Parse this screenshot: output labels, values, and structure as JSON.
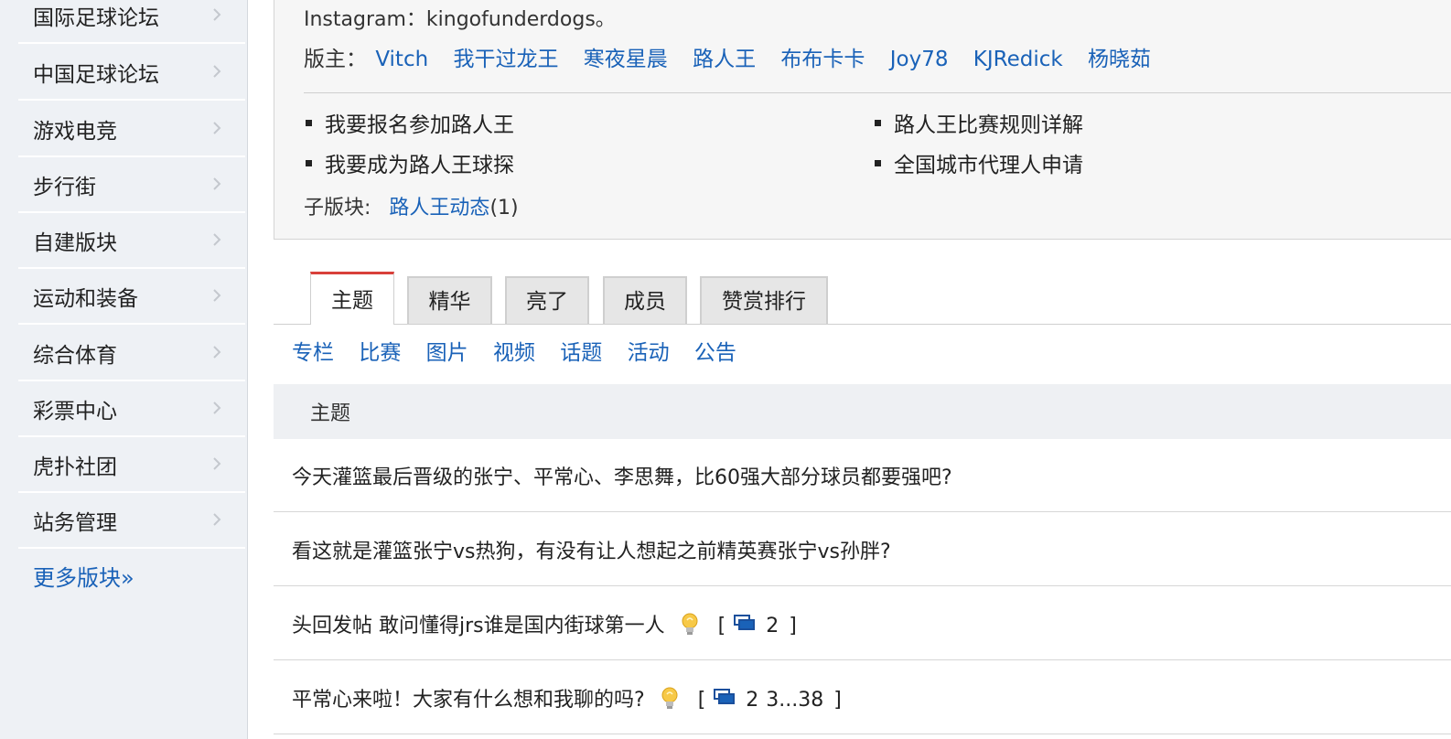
{
  "sidebar": {
    "items": [
      {
        "label": "国际足球论坛"
      },
      {
        "label": "中国足球论坛"
      },
      {
        "label": "游戏电竞"
      },
      {
        "label": "步行街"
      },
      {
        "label": "自建版块"
      },
      {
        "label": "运动和装备"
      },
      {
        "label": "综合体育"
      },
      {
        "label": "彩票中心"
      },
      {
        "label": "虎扑社团"
      },
      {
        "label": "站务管理"
      }
    ],
    "more_label": "更多版块»"
  },
  "info": {
    "instagram_text": "Instagram：kingofunderdogs。",
    "moderators_label": "版主：",
    "moderators": [
      "Vitch",
      "我干过龙王",
      "寒夜星晨",
      "路人王",
      "布布卡卡",
      "Joy78",
      "KJRedick",
      "杨晓茹"
    ],
    "links": [
      {
        "label": "我要报名参加路人王"
      },
      {
        "label": "路人王比赛规则详解"
      },
      {
        "label": "我要成为路人王球探"
      },
      {
        "label": "全国城市代理人申请"
      }
    ],
    "subforum_label": "子版块:",
    "subforum_link": "路人王动态",
    "subforum_count": "(1)"
  },
  "tabs": [
    {
      "label": "主题",
      "active": true
    },
    {
      "label": "精华",
      "active": false
    },
    {
      "label": "亮了",
      "active": false
    },
    {
      "label": "成员",
      "active": false
    },
    {
      "label": "赞赏排行",
      "active": false
    }
  ],
  "filters": [
    "专栏",
    "比赛",
    "图片",
    "视频",
    "话题",
    "活动",
    "公告"
  ],
  "list": {
    "header": "主题",
    "threads": [
      {
        "title": "今天灌篮最后晋级的张宁、平常心、李思舞，比60强大部分球员都要强吧?"
      },
      {
        "title": "看这就是灌篮张宁vs热狗，有没有让人想起之前精英赛张宁vs孙胖?"
      },
      {
        "title": "头回发帖 敢问懂得jrs谁是国内街球第一人",
        "pages": [
          "2"
        ]
      },
      {
        "title": "平常心来啦！大家有什么想和我聊的吗?",
        "pages": [
          "2",
          "3...38"
        ]
      }
    ]
  },
  "colors": {
    "link": "#1a62b8",
    "active_tab_accent": "#d9403a",
    "sidebar_bg": "#eef1f5"
  },
  "icons": [
    "chevron-right-icon",
    "lightbulb-icon",
    "page-stack-icon"
  ]
}
